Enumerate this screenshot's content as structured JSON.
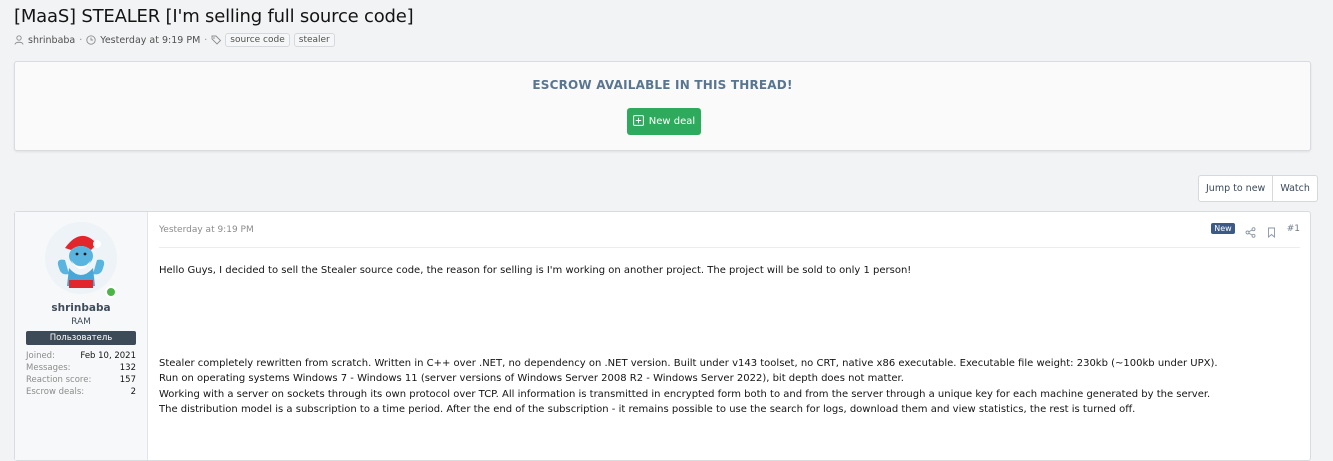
{
  "thread": {
    "title": "[MaaS] STEALER [I'm selling full source code]",
    "author": "shrinbaba",
    "date": "Yesterday at 9:19 PM",
    "tags": [
      "source code",
      "stealer"
    ]
  },
  "escrow": {
    "title": "ESCROW AVAILABLE IN THIS THREAD!",
    "new_deal_label": "New deal"
  },
  "controls": {
    "jump_to_new": "Jump to new",
    "watch": "Watch"
  },
  "post": {
    "date": "Yesterday at 9:19 PM",
    "badge": "New",
    "number": "#1",
    "user": {
      "name": "shrinbaba",
      "title": "RAM",
      "banner": "Пользователь",
      "stats": [
        {
          "label": "Joined:",
          "value": "Feb 10, 2021"
        },
        {
          "label": "Messages:",
          "value": "132"
        },
        {
          "label": "Reaction score:",
          "value": "157"
        },
        {
          "label": "Escrow deals:",
          "value": "2"
        }
      ]
    },
    "body": {
      "intro": "Hello Guys, I decided to sell the Stealer source code, the reason for selling is I'm working on another project. The project will be sold to only 1 person!",
      "lines": [
        "Stealer completely rewritten from scratch. Written in C++ over .NET, no dependency on .NET version. Built under v143 toolset, no CRT, native x86 executable. Executable file weight: 230kb (~100kb under UPX).",
        "Run on operating systems Windows 7 - Windows 11 (server versions of Windows Server 2008 R2 - Windows Server 2022), bit depth does not matter.",
        "Working with a server on sockets through its own protocol over TCP. All information is transmitted in encrypted form both to and from the server through a unique key for each machine generated by the server.",
        "The distribution model is a subscription to a time period. After the end of the subscription - it remains possible to use the search for logs, download them and view statistics, the rest is turned off."
      ]
    }
  },
  "colors": {
    "accent_green": "#2eaa5c",
    "escrow_title": "#5a7590",
    "banner_bg": "#3d4a58",
    "new_badge": "#3c5a86"
  }
}
